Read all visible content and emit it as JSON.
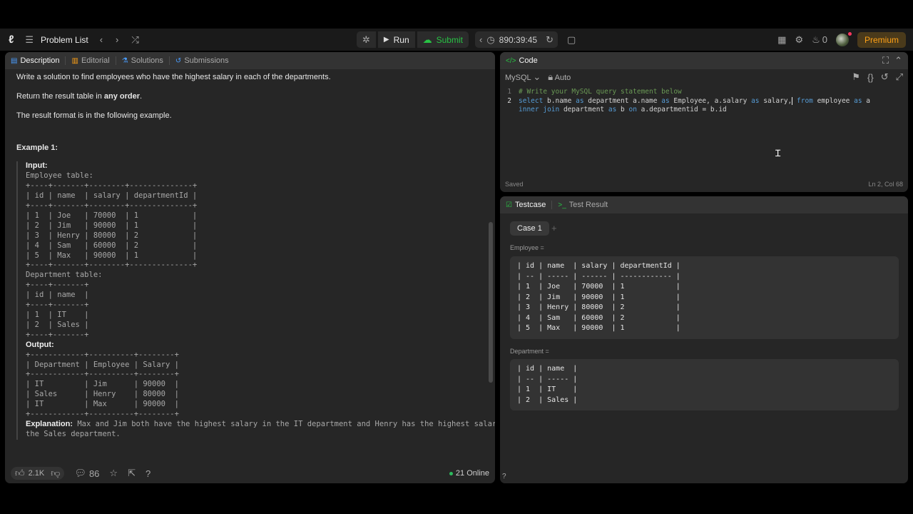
{
  "nav": {
    "problem_list": "Problem List",
    "run": "Run",
    "submit": "Submit",
    "timer": "890:39:45",
    "notifications": "0",
    "premium": "Premium"
  },
  "left_panel": {
    "tabs": [
      "Description",
      "Editorial",
      "Solutions",
      "Submissions"
    ],
    "paragraphs": [
      "Write a solution to find employees who have the highest salary in each of the departments.",
      "Return the result table in ",
      "any order",
      ".",
      "The result format is in the following example."
    ],
    "example_title": "Example 1:",
    "input_label": "Input:",
    "employee_table": "Employee table:\n+----+-------+--------+--------------+\n| id | name  | salary | departmentId |\n+----+-------+--------+--------------+\n| 1  | Joe   | 70000  | 1            |\n| 2  | Jim   | 90000  | 1            |\n| 3  | Henry | 80000  | 2            |\n| 4  | Sam   | 60000  | 2            |\n| 5  | Max   | 90000  | 1            |\n+----+-------+--------+--------------+",
    "department_table": "Department table:\n+----+-------+\n| id | name  |\n+----+-------+\n| 1  | IT    |\n| 2  | Sales |\n+----+-------+",
    "output_label": "Output:",
    "output_table": "+------------+----------+--------+\n| Department | Employee | Salary |\n+------------+----------+--------+\n| IT         | Jim      | 90000  |\n| Sales      | Henry    | 80000  |\n| IT         | Max      | 90000  |\n+------------+----------+--------+",
    "explanation_label": "Explanation:",
    "explanation_text": " Max and Jim both have the highest salary in the IT department and Henry has the highest salary in\nthe Sales department.",
    "likes": "2.1K",
    "comments": "86",
    "online": "21 Online"
  },
  "code_panel": {
    "title": "Code",
    "language": "MySQL",
    "mode": "Auto",
    "line_numbers": [
      "1",
      "2"
    ],
    "comment_line": "# Write your MySQL query statement below",
    "status": "Saved",
    "cursor_pos": "Ln 2, Col 68"
  },
  "test_panel": {
    "tabs": [
      "Testcase",
      "Test Result"
    ],
    "case_label": "Case 1",
    "employee_label": "Employee =",
    "employee_block": "| id | name  | salary | departmentId |\n| -- | ----- | ------ | ------------ |\n| 1  | Joe   | 70000  | 1            |\n| 2  | Jim   | 90000  | 1            |\n| 3  | Henry | 80000  | 2            |\n| 4  | Sam   | 60000  | 2            |\n| 5  | Max   | 90000  | 1            |",
    "department_label": "Department =",
    "department_block": "| id | name  |\n| -- | ----- |\n| 1  | IT    |\n| 2  | Sales |"
  },
  "colors": {
    "accent": "#ffa116",
    "submit_green": "#28c244",
    "keyword_blue": "#569cd6"
  }
}
